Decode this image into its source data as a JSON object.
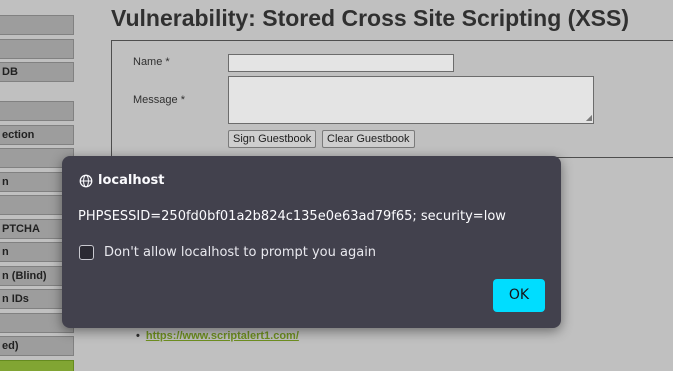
{
  "sidebar": {
    "items": [
      {
        "label": ""
      },
      {
        "label": ""
      },
      {
        "label": "DB"
      },
      {
        "label": ""
      },
      {
        "label": "ection"
      },
      {
        "label": ""
      },
      {
        "label": "n"
      },
      {
        "label": ""
      },
      {
        "label": "PTCHA"
      },
      {
        "label": "n"
      },
      {
        "label": "n (Blind)"
      },
      {
        "label": "n IDs"
      },
      {
        "label": ""
      },
      {
        "label": "ed)"
      },
      {
        "label": ""
      }
    ]
  },
  "main": {
    "title": "Vulnerability: Stored Cross Site Scripting (XSS)",
    "form": {
      "name_label": "Name *",
      "message_label": "Message *",
      "name_value": "",
      "message_value": "",
      "sign_button": "Sign Guestbook",
      "clear_button": "Clear Guestbook"
    },
    "links": [
      {
        "text": "https://www.scriptalert1.com/"
      }
    ]
  },
  "dialog": {
    "origin": "localhost",
    "message": "PHPSESSID=250fd0bf01a2b824c135e0e63ad79f65; security=low",
    "checkbox_label": "Don't allow localhost to prompt you again",
    "checkbox_checked": false,
    "ok_label": "OK",
    "ok_color": "#00ddff",
    "background_color": "#42414d"
  },
  "theme": {
    "page_bg": "#d6d6d6",
    "sidebar_button_bg": "#afafaf",
    "sidebar_active_bg": "#8fb836",
    "link_color": "#7aa020"
  }
}
